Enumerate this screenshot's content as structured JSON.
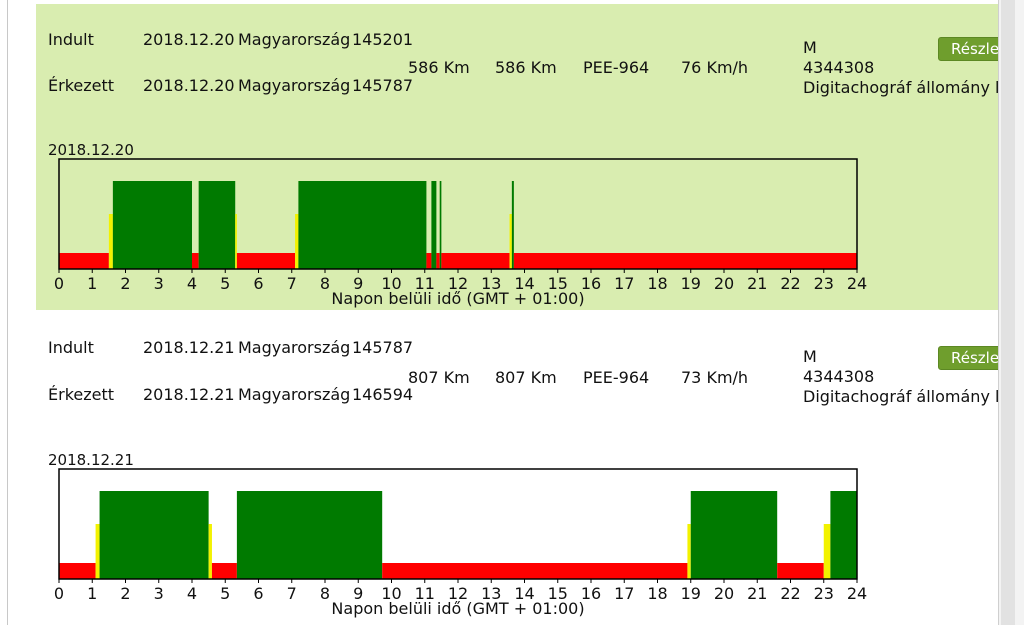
{
  "entries": [
    {
      "start_label": "Indult",
      "start_date": "2018.12.20",
      "start_country": "Magyarország",
      "start_odo": "145201",
      "end_label": "Érkezett",
      "end_date": "2018.12.20",
      "end_country": "Magyarország",
      "end_odo": "145787",
      "distance1": "586 Km",
      "distance2": "586 Km",
      "plate": "PEE-964",
      "speed": "76 Km/h",
      "type": "M",
      "card_id": "4344308",
      "file_label": "Digitachográf állomány letö",
      "details_button": "Részlet",
      "chart_date": "2018.12.20",
      "axis_title": "Napon belüli idő (GMT + 01:00)",
      "activity": [
        {
          "kind": "rest",
          "start": 0.0,
          "end": 1.5
        },
        {
          "kind": "avail",
          "start": 1.5,
          "end": 1.62
        },
        {
          "kind": "drive",
          "start": 1.62,
          "end": 4.0
        },
        {
          "kind": "rest",
          "start": 4.0,
          "end": 4.2
        },
        {
          "kind": "drive",
          "start": 4.2,
          "end": 5.3
        },
        {
          "kind": "avail",
          "start": 5.3,
          "end": 5.35
        },
        {
          "kind": "rest",
          "start": 5.35,
          "end": 7.1
        },
        {
          "kind": "avail",
          "start": 7.1,
          "end": 7.2
        },
        {
          "kind": "drive",
          "start": 7.2,
          "end": 11.05
        },
        {
          "kind": "rest",
          "start": 11.05,
          "end": 11.2
        },
        {
          "kind": "drive",
          "start": 11.2,
          "end": 11.35
        },
        {
          "kind": "rest",
          "start": 11.35,
          "end": 11.45
        },
        {
          "kind": "drive",
          "start": 11.45,
          "end": 11.5
        },
        {
          "kind": "rest",
          "start": 11.5,
          "end": 13.55
        },
        {
          "kind": "avail",
          "start": 13.55,
          "end": 13.62
        },
        {
          "kind": "drive",
          "start": 13.62,
          "end": 13.68
        },
        {
          "kind": "rest",
          "start": 13.68,
          "end": 24.0
        }
      ]
    },
    {
      "start_label": "Indult",
      "start_date": "2018.12.21",
      "start_country": "Magyarország",
      "start_odo": "145787",
      "end_label": "Érkezett",
      "end_date": "2018.12.21",
      "end_country": "Magyarország",
      "end_odo": "146594",
      "distance1": "807 Km",
      "distance2": "807 Km",
      "plate": "PEE-964",
      "speed": "73 Km/h",
      "type": "M",
      "card_id": "4344308",
      "file_label": "Digitachográf állomány letö",
      "details_button": "Részlet",
      "chart_date": "2018.12.21",
      "axis_title": "Napon belüli idő (GMT + 01:00)",
      "activity": [
        {
          "kind": "rest",
          "start": 0.0,
          "end": 1.1
        },
        {
          "kind": "avail",
          "start": 1.1,
          "end": 1.22
        },
        {
          "kind": "drive",
          "start": 1.22,
          "end": 4.5
        },
        {
          "kind": "avail",
          "start": 4.5,
          "end": 4.6
        },
        {
          "kind": "rest",
          "start": 4.6,
          "end": 5.35
        },
        {
          "kind": "drive",
          "start": 5.35,
          "end": 9.72
        },
        {
          "kind": "rest",
          "start": 9.72,
          "end": 18.9
        },
        {
          "kind": "avail",
          "start": 18.9,
          "end": 19.0
        },
        {
          "kind": "drive",
          "start": 19.0,
          "end": 21.6
        },
        {
          "kind": "rest",
          "start": 21.6,
          "end": 23.0
        },
        {
          "kind": "avail",
          "start": 23.0,
          "end": 23.2
        },
        {
          "kind": "drive",
          "start": 23.2,
          "end": 24.0
        }
      ]
    }
  ],
  "colors": {
    "drive": "#007a00",
    "rest": "#ff0000",
    "avail": "#f2f200",
    "green_bg": "#d9edb0",
    "button": "#6f9e2d"
  }
}
